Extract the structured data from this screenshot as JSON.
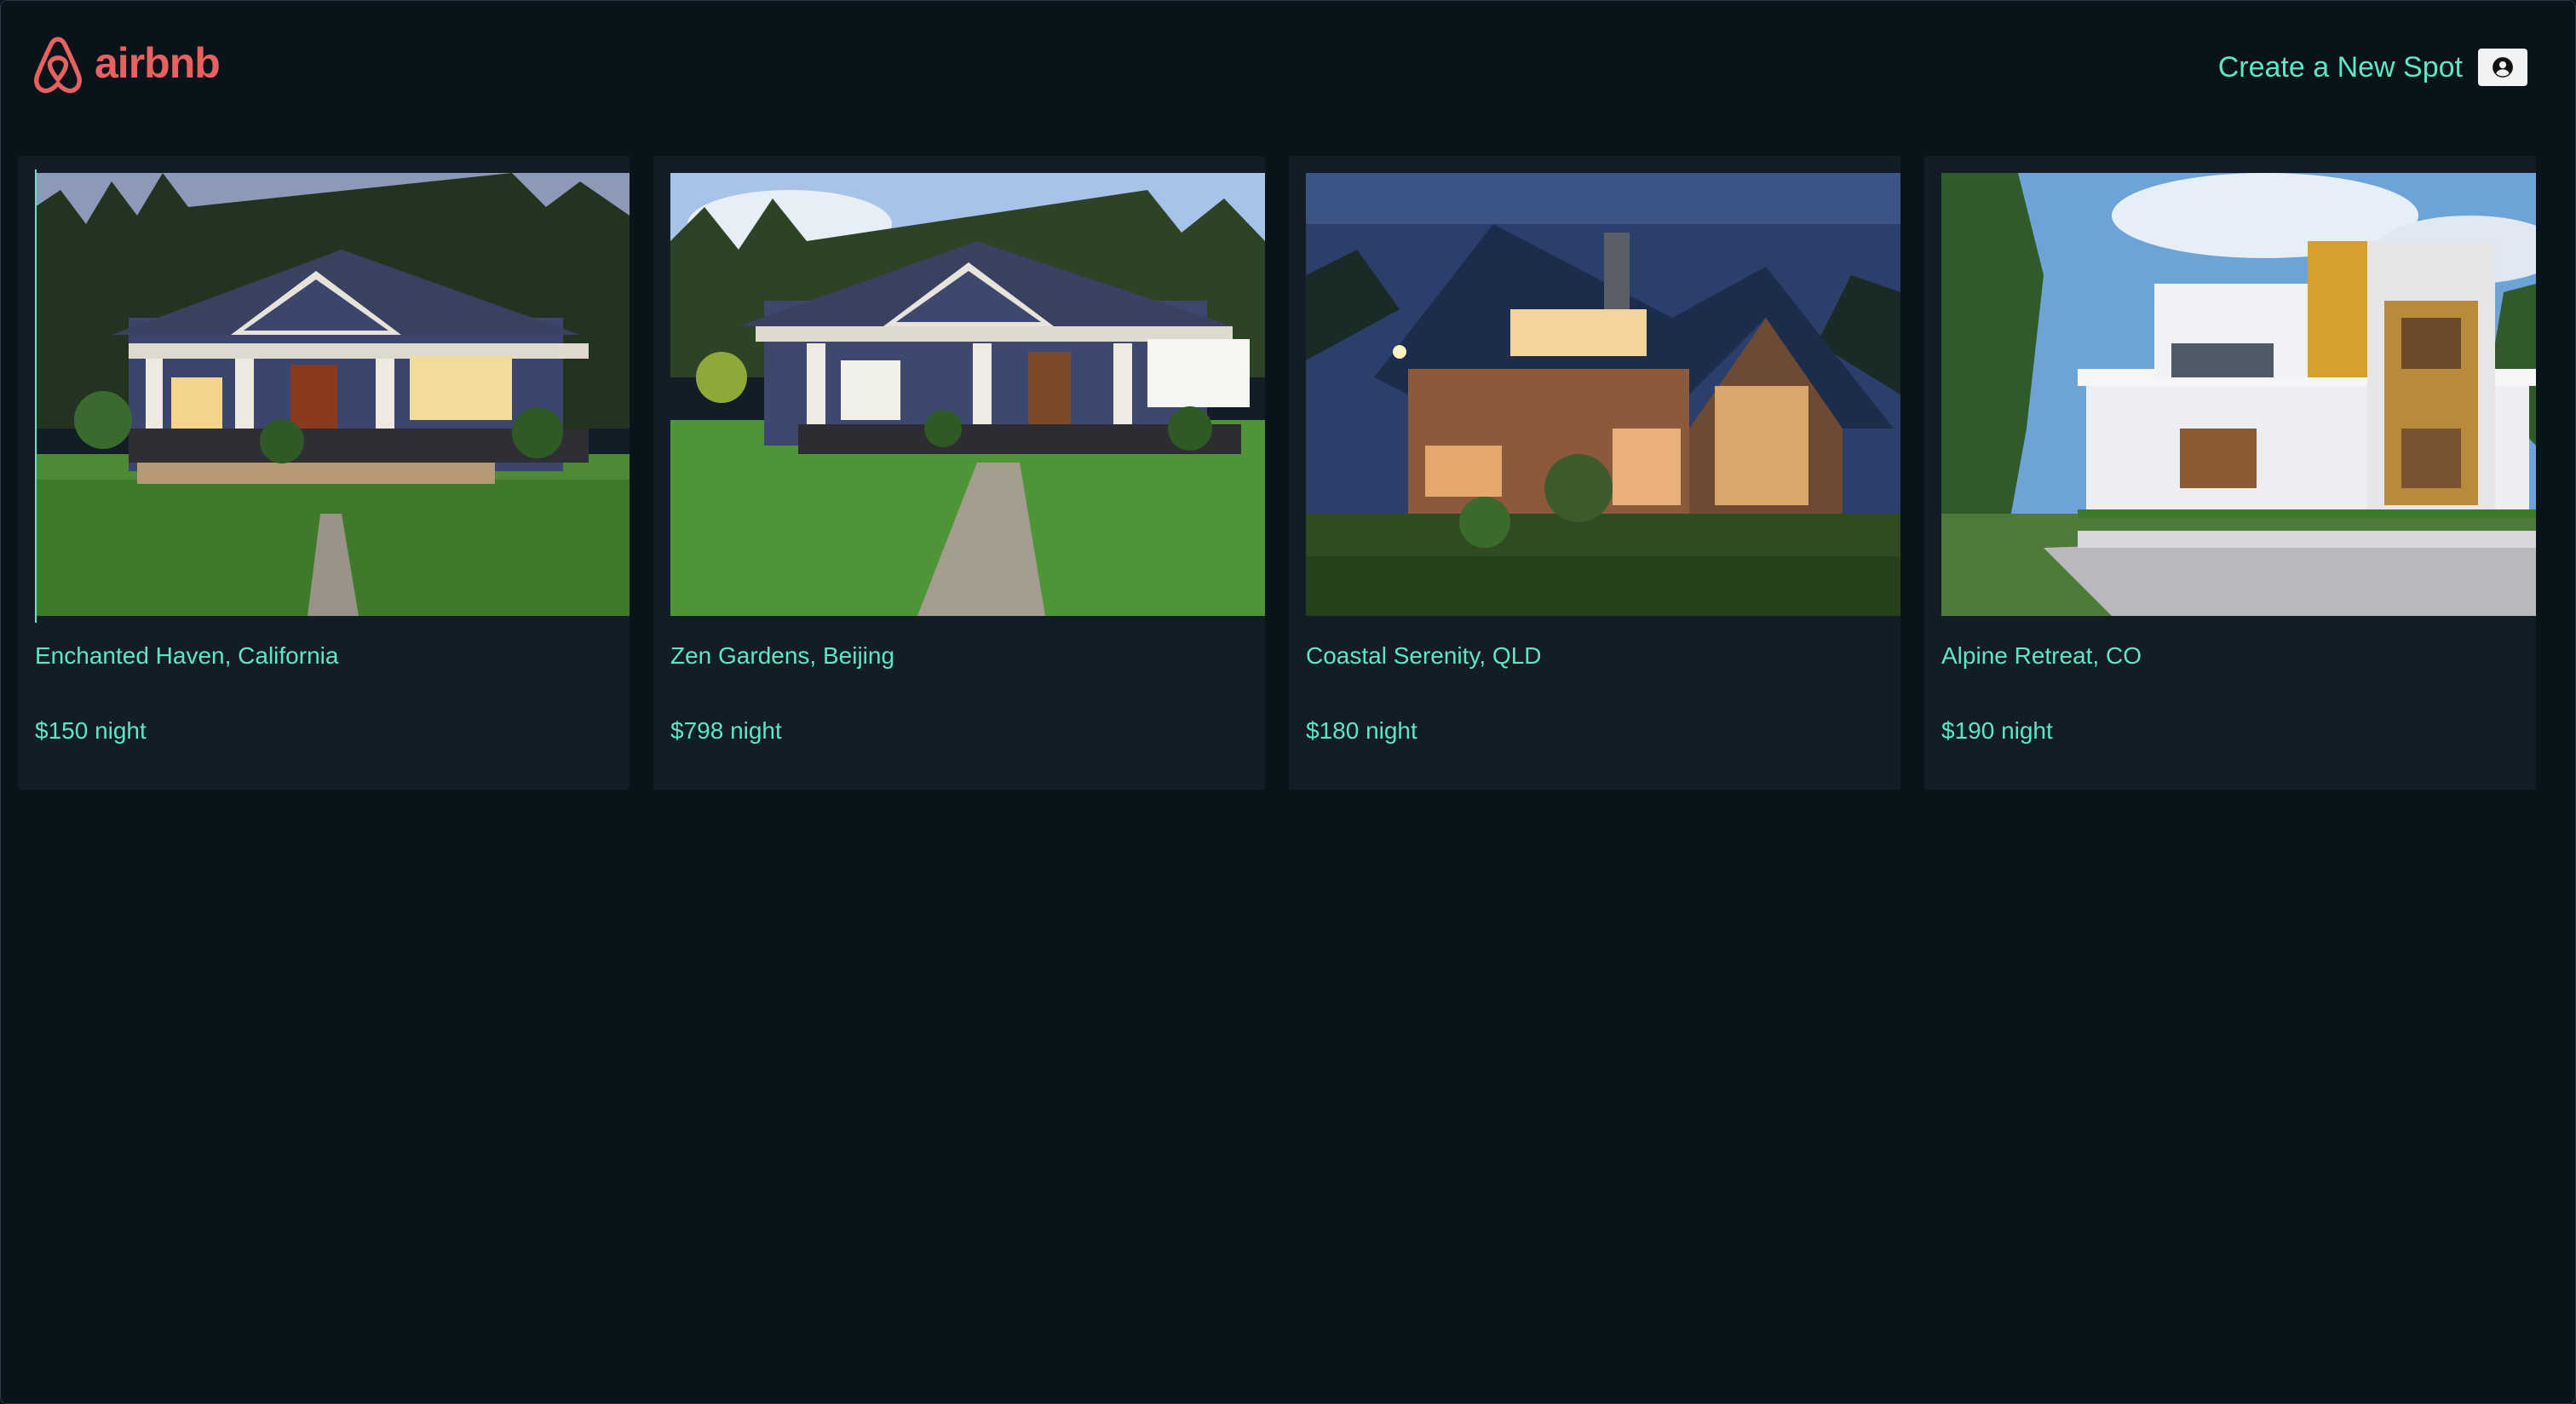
{
  "header": {
    "brand": "airbnb",
    "logo_icon": "airbnb-belo-icon",
    "create_link": "Create a New Spot",
    "profile_icon": "user-circle-icon"
  },
  "colors": {
    "background": "#09131a",
    "card": "#121d27",
    "accent": "#5fe6c4",
    "brand": "#e8605f"
  },
  "spots": [
    {
      "title": "Enchanted Haven, California",
      "price": "$150 night",
      "image": "navy craftsman house at dusk with stone walkway"
    },
    {
      "title": "Zen Gardens, Beijing",
      "price": "$798 night",
      "image": "navy craftsman house with lawn and paver path"
    },
    {
      "title": "Coastal Serenity, QLD",
      "price": "$180 night",
      "image": "wooden A-frame house lit at night"
    },
    {
      "title": "Alpine Retreat, CO",
      "price": "$190 night",
      "image": "modern white and yellow two-story villa"
    }
  ]
}
